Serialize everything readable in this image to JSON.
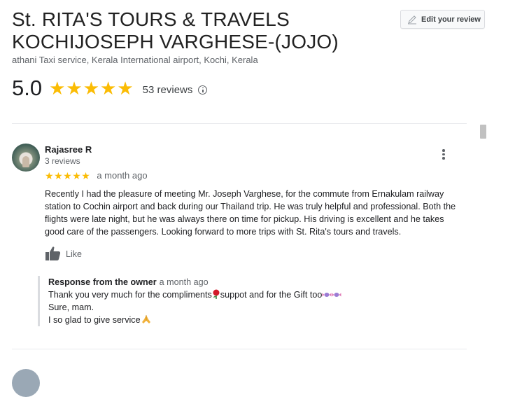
{
  "header": {
    "title_line1": "St. RITA'S TOURS & TRAVELS",
    "title_line2": "KOCHIJOSEPH VARGHESE-(JOJO)",
    "subtitle": "athani Taxi service, Kerala International airport, Kochi, Kerala",
    "edit_review_label": "Edit your review",
    "rating": "5.0",
    "rating_stars": 5,
    "reviews_count": "53 reviews"
  },
  "review": {
    "name": "Rajasree R",
    "meta": "3 reviews",
    "stars": 5,
    "time": "a month ago",
    "text": "Recently I had the pleasure of meeting Mr. Joseph Varghese, for the commute from Ernakulam railway station to Cochin airport and back during our Thailand trip. He was truly helpful and professional. Both the flights were late night, but he was always there on time for pickup. His driving is excellent and he takes good care of the passengers. Looking forward to more trips with St. Rita's tours and travels.",
    "like_label": "Like",
    "response": {
      "label": "Response from the owner",
      "time": "a month ago",
      "line1_a": "Thank you very much for the compliments",
      "line1_b": "suppot and for the Gift too",
      "line2": "Sure, mam.",
      "line3": "I so glad to give service"
    }
  },
  "icons": {
    "edit": "pencil-icon",
    "info": "info-icon",
    "more": "more-vert-icon",
    "like": "thumb-up-icon",
    "rose": "rose-emoji",
    "candy": "candy-emoji",
    "pray": "folded-hands-emoji"
  },
  "colors": {
    "star": "#fbbc04",
    "text": "#202124",
    "muted": "#5f6368",
    "divider": "#e8eaed"
  }
}
